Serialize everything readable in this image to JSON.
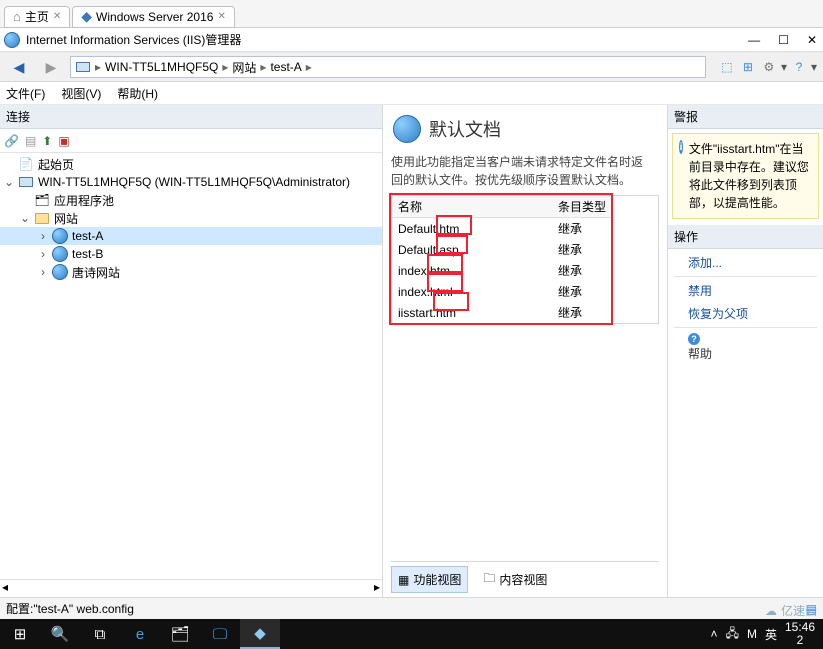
{
  "browser_tabs": {
    "home": "主页",
    "active": "Windows Server 2016"
  },
  "window": {
    "title": "Internet Information Services (IIS)管理器"
  },
  "breadcrumb": {
    "root": "WIN-TT5L1MHQF5Q",
    "sites": "网站",
    "site": "test-A"
  },
  "menubar": {
    "file": "文件(F)",
    "view": "视图(V)",
    "help": "帮助(H)"
  },
  "left": {
    "header": "连接",
    "nodes": {
      "start": "起始页",
      "server": "WIN-TT5L1MHQF5Q (WIN-TT5L1MHQF5Q\\Administrator)",
      "apppools": "应用程序池",
      "sites": "网站",
      "testA": "test-A",
      "testB": "test-B",
      "poem": "唐诗网站"
    }
  },
  "center": {
    "title": "默认文档",
    "desc": "使用此功能指定当客户端未请求特定文件名时返回的默认文件。按优先级顺序设置默认文档。",
    "col_name": "名称",
    "col_type": "条目类型",
    "rows": [
      {
        "name": "Default.htm",
        "type": "继承"
      },
      {
        "name": "Default.asp",
        "type": "继承"
      },
      {
        "name": "index.htm",
        "type": "继承"
      },
      {
        "name": "index.html",
        "type": "继承"
      },
      {
        "name": "iisstart.htm",
        "type": "继承"
      }
    ],
    "view_features": "功能视图",
    "view_content": "内容视图"
  },
  "right": {
    "alerts_hdr": "警报",
    "alert_text": "文件\"iisstart.htm\"在当前目录中存在。建议您将此文件移到列表顶部，以提高性能。",
    "actions_hdr": "操作",
    "add": "添加...",
    "disable": "禁用",
    "reset": "恢复为父项",
    "help": "帮助"
  },
  "statusbar": {
    "text": "配置:\"test-A\" web.config"
  },
  "taskbar": {
    "ime1": "M",
    "ime2": "英",
    "time": "15:46",
    "date": "2"
  },
  "watermark": "亿速云"
}
